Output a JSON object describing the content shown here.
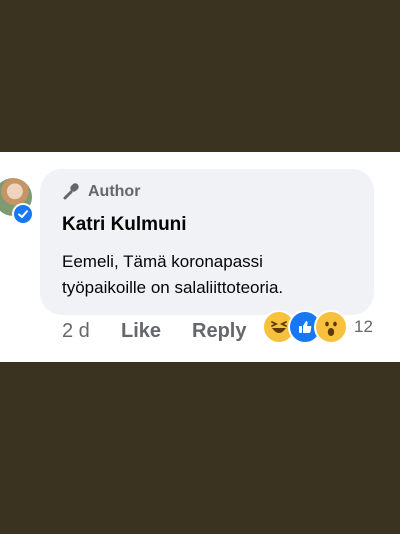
{
  "comment": {
    "badge": "Author",
    "name": "Katri Kulmuni",
    "text_line1": "Eemeli, Tämä koronapassi",
    "text_line2": "työpaikoille on salaliittoteoria."
  },
  "actions": {
    "time": "2 d",
    "like": "Like",
    "reply": "Reply"
  },
  "reactions": {
    "icons": [
      "haha-icon",
      "like-icon",
      "wow-icon"
    ],
    "count": "12"
  },
  "colors": {
    "background": "#3a3320",
    "bubble": "#f0f2f5",
    "verified": "#1877f2",
    "muted": "#65676b"
  }
}
